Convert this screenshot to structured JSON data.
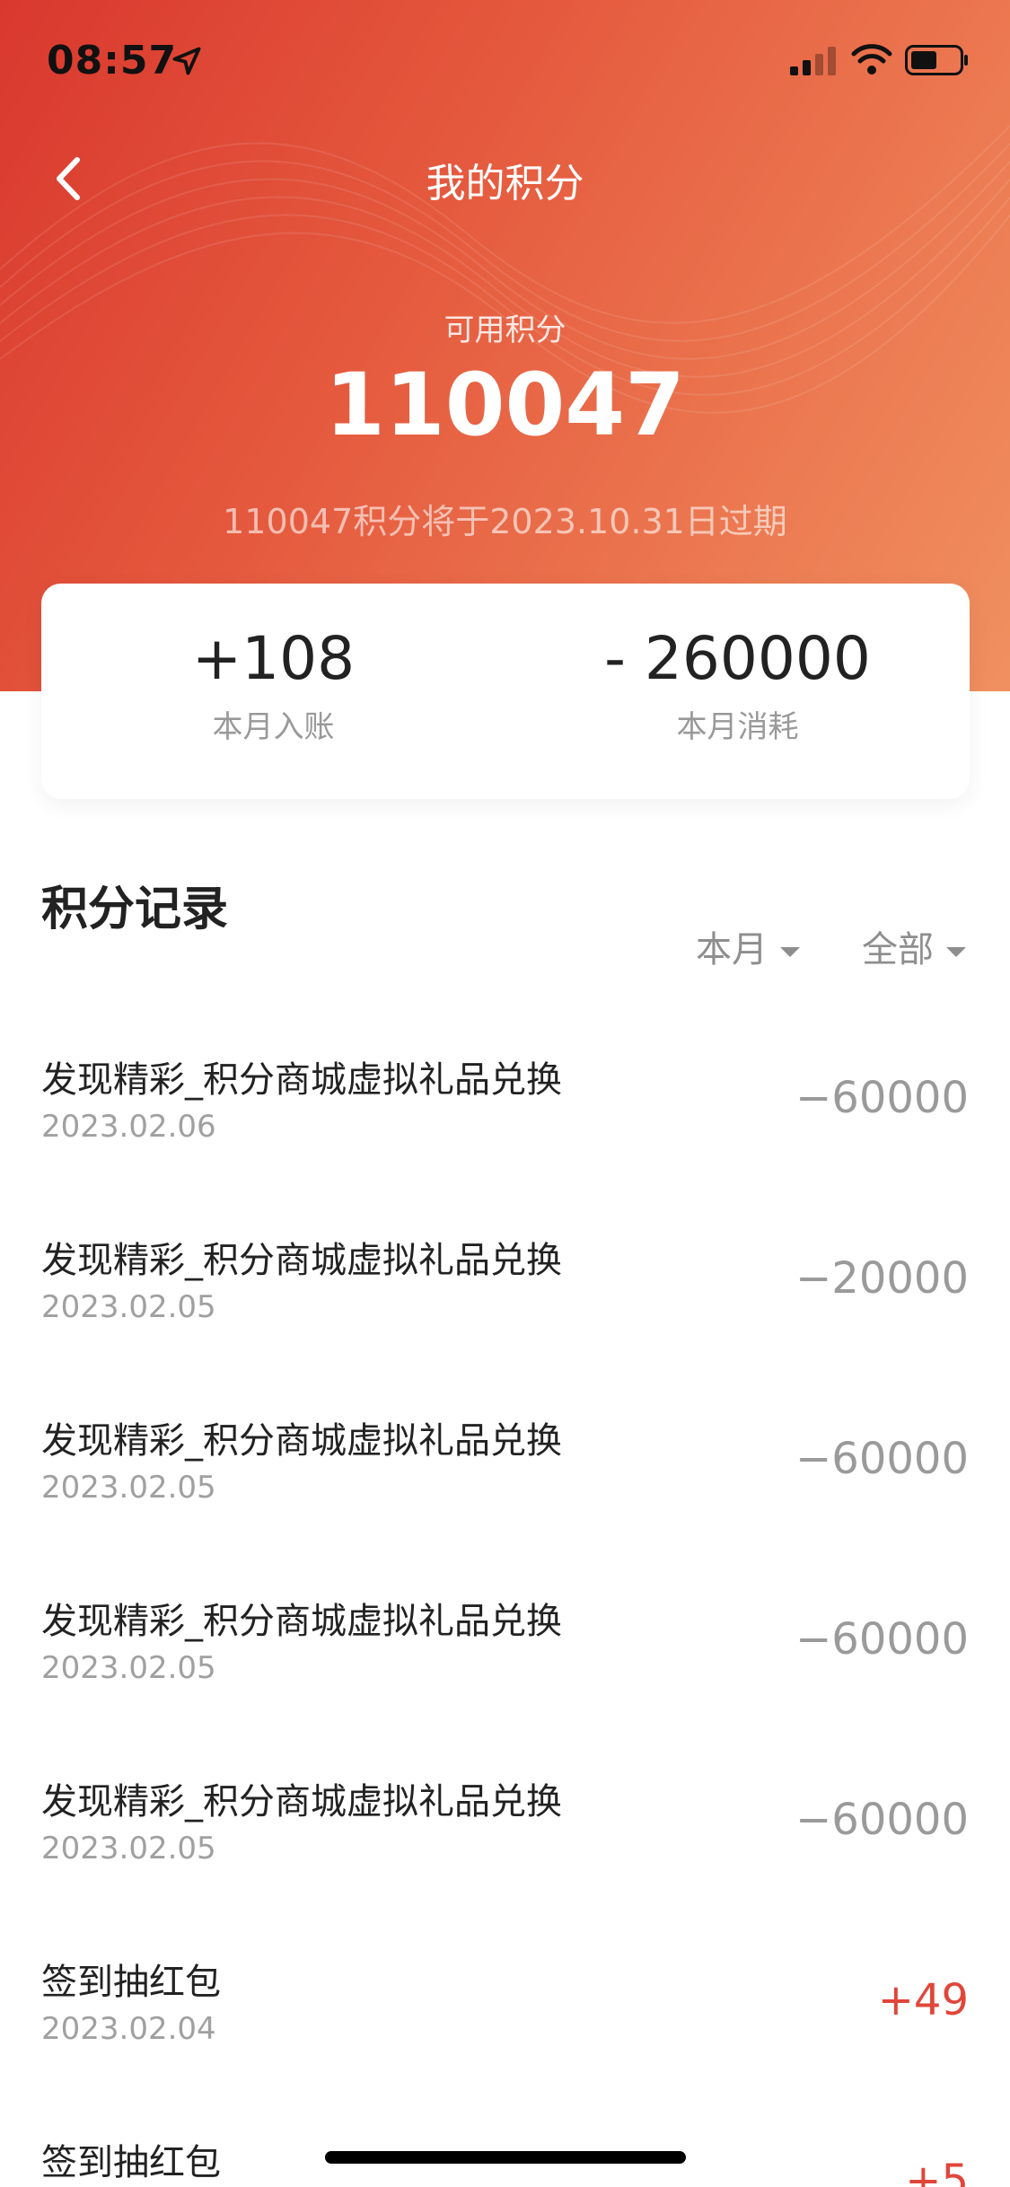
{
  "status_bar": {
    "time": "08:57"
  },
  "nav": {
    "title": "我的积分"
  },
  "points": {
    "label": "可用积分",
    "value": "110047",
    "expiry_note": "110047积分将于2023.10.31日过期"
  },
  "summary": {
    "income_value": "+108",
    "income_label": "本月入账",
    "spend_value": "- 260000",
    "spend_label": "本月消耗"
  },
  "records_section": {
    "title": "积分记录",
    "filter_period": "本月",
    "filter_type": "全部"
  },
  "records": [
    {
      "title": "发现精彩_积分商城虚拟礼品兑换",
      "date": "2023.02.06",
      "amount": "−60000"
    },
    {
      "title": "发现精彩_积分商城虚拟礼品兑换",
      "date": "2023.02.05",
      "amount": "−20000"
    },
    {
      "title": "发现精彩_积分商城虚拟礼品兑换",
      "date": "2023.02.05",
      "amount": "−60000"
    },
    {
      "title": "发现精彩_积分商城虚拟礼品兑换",
      "date": "2023.02.05",
      "amount": "−60000"
    },
    {
      "title": "发现精彩_积分商城虚拟礼品兑换",
      "date": "2023.02.05",
      "amount": "−60000"
    },
    {
      "title": "签到抽红包",
      "date": "2023.02.04",
      "amount": "+49"
    },
    {
      "title": "签到抽红包",
      "date": "",
      "amount": "+5"
    }
  ],
  "colors": {
    "header_gradient_start": "#d9382e",
    "header_gradient_end": "#f09060",
    "positive_amount": "#e0463a",
    "negative_amount": "#9a9a9a"
  },
  "icons": [
    "back-chevron-icon",
    "location-arrow-icon",
    "signal-icon",
    "wifi-icon",
    "battery-icon",
    "caret-down-icon"
  ]
}
